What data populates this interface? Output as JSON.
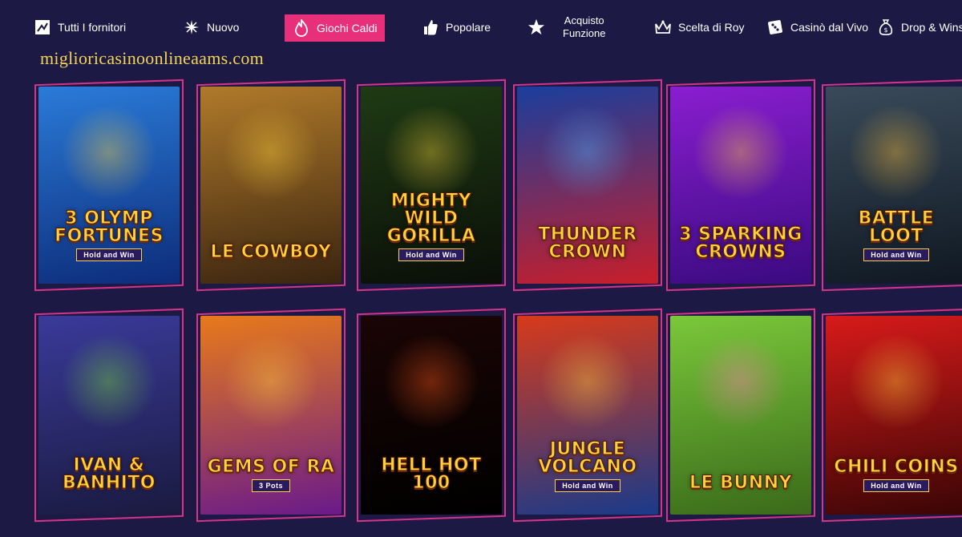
{
  "nav": {
    "items": [
      {
        "label": "Tutti I fornitori",
        "icon": "provider-icon"
      },
      {
        "label": "Nuovo",
        "icon": "sparkle-icon"
      },
      {
        "label": "Giochi Caldi",
        "icon": "flame-icon"
      },
      {
        "label": "Popolare",
        "icon": "thumbs-up-icon"
      },
      {
        "label": "Acquisto\nFunzione",
        "icon": "star-icon"
      },
      {
        "label": "Scelta di Roy",
        "icon": "crown-icon"
      },
      {
        "label": "Casinò dal Vivo",
        "icon": "dice-icon"
      },
      {
        "label": "Drop & Wins",
        "icon": "money-bag-icon"
      }
    ],
    "active_index": 2
  },
  "watermark": "miglioricasinoonlineaams.com",
  "games": [
    {
      "title": "3 Olymp Fortunes",
      "tag": "Hold and Win",
      "bg": [
        "#2a7bd8",
        "#0d2c7a"
      ],
      "accent": "#ffd23a"
    },
    {
      "title": "Le Cowboy",
      "tag": "",
      "bg": [
        "#b07a2a",
        "#3a2410"
      ],
      "accent": "#ffd23a"
    },
    {
      "title": "Mighty Wild Gorilla",
      "tag": "Hold and Win",
      "bg": [
        "#1f3a14",
        "#0a0f08"
      ],
      "accent": "#f4d23a"
    },
    {
      "title": "Thunder Crown",
      "tag": "",
      "bg": [
        "#1a3e9c",
        "#c81e2a"
      ],
      "accent": "#4fb8ff"
    },
    {
      "title": "3 Sparking Crowns",
      "tag": "",
      "bg": [
        "#8a1ed0",
        "#3a0a80"
      ],
      "accent": "#ffd23a"
    },
    {
      "title": "Battle Loot",
      "tag": "Hold and Win",
      "bg": [
        "#3a4a5a",
        "#0f1822"
      ],
      "accent": "#ffc23a"
    },
    {
      "title": "Ivan & Banhito",
      "tag": "",
      "bg": [
        "#3a3a9a",
        "#1a1a40"
      ],
      "accent": "#7be23a"
    },
    {
      "title": "Gems of Ra",
      "tag": "3 Pots",
      "bg": [
        "#e87a1a",
        "#6a1a8a"
      ],
      "accent": "#ffd23a"
    },
    {
      "title": "Hell Hot 100",
      "tag": "",
      "bg": [
        "#1a0505",
        "#000000"
      ],
      "accent": "#ff5a1a"
    },
    {
      "title": "Jungle Volcano",
      "tag": "Hold and Win",
      "bg": [
        "#d83a1a",
        "#1a3a8a"
      ],
      "accent": "#ffd23a"
    },
    {
      "title": "Le Bunny",
      "tag": "",
      "bg": [
        "#7ac83a",
        "#3a6a1a"
      ],
      "accent": "#ff7ab8"
    },
    {
      "title": "Chili Coins",
      "tag": "Hold and Win",
      "bg": [
        "#d81a1a",
        "#3a0505"
      ],
      "accent": "#ffd23a"
    }
  ],
  "colors": {
    "background": "#1c1a44",
    "active": "#e8307a",
    "frame": "#d8338a",
    "watermark": "#f2d35a"
  }
}
